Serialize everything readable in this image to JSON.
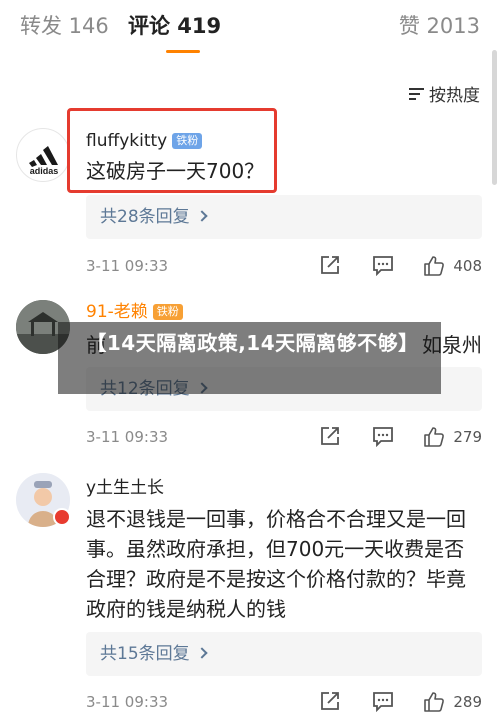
{
  "tabs": {
    "repost": "转发 146",
    "comment": "评论 419",
    "like": "赞 2013"
  },
  "sort": {
    "label": "按热度"
  },
  "comments": [
    {
      "username": "fluffykitty",
      "badge": "铁粉",
      "avatar_text": "adidas",
      "text": "这破房子一天700？",
      "replies": "共28条回复",
      "time": "3-11 09:33",
      "likes": "408",
      "name_color": "#333333"
    },
    {
      "username": "91-老赖",
      "badge": "铁粉",
      "text": "前... 如泉州",
      "text_left": "前",
      "text_right": "如泉州",
      "replies": "共12条回复",
      "time": "3-11 09:33",
      "likes": "279",
      "name_color": "#ff8200"
    },
    {
      "username": "y土生土长",
      "text": "退不退钱是一回事，价格合不合理又是一回事。虽然政府承担，但700元一天收费是否合理？政府是不是按这个价格付款的？毕竟政府的钱是纳税人的钱",
      "replies": "共15条回复",
      "time": "3-11 09:33",
      "likes": "289",
      "name_color": "#333333"
    }
  ],
  "overlay": {
    "title": "【14天隔离政策,14天隔离够不够】"
  },
  "colors": {
    "accent": "#ff8200",
    "highlight_box": "#e53b2f",
    "link": "#5d7896",
    "badge": "#6ea4e8"
  }
}
